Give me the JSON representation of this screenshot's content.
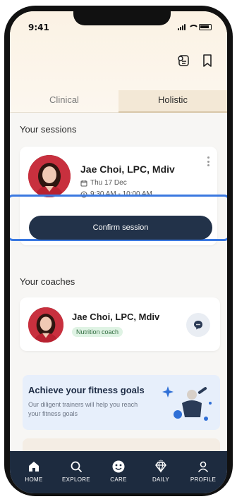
{
  "status_bar": {
    "time": "9:41"
  },
  "tabs": [
    {
      "label": "Clinical",
      "active": false
    },
    {
      "label": "Holistic",
      "active": true
    }
  ],
  "sessions": {
    "title": "Your sessions",
    "card": {
      "name": "Jae Choi, LPC, Mdiv",
      "date": "Thu 17 Dec",
      "time": "9:30 AM - 10:00 AM",
      "confirm_label": "Confirm session"
    }
  },
  "coaches": {
    "title": "Your coaches",
    "card": {
      "name": "Jae Choi, LPC, Mdiv",
      "role": "Nutrition coach"
    }
  },
  "promo": {
    "title": "Achieve your fitness goals",
    "subtitle": "Our diligent trainers will help you reach your fitness goals"
  },
  "nav": [
    {
      "label": "HOME",
      "icon": "home-icon"
    },
    {
      "label": "EXPLORE",
      "icon": "search-icon"
    },
    {
      "label": "CARE",
      "icon": "care-icon"
    },
    {
      "label": "DAILY",
      "icon": "diamond-icon"
    },
    {
      "label": "PROFILE",
      "icon": "profile-icon"
    }
  ],
  "colors": {
    "primary_dark": "#223249",
    "highlight": "#3a78e0",
    "badge_bg": "#dff3e4",
    "promo_bg": "#e7effb"
  }
}
